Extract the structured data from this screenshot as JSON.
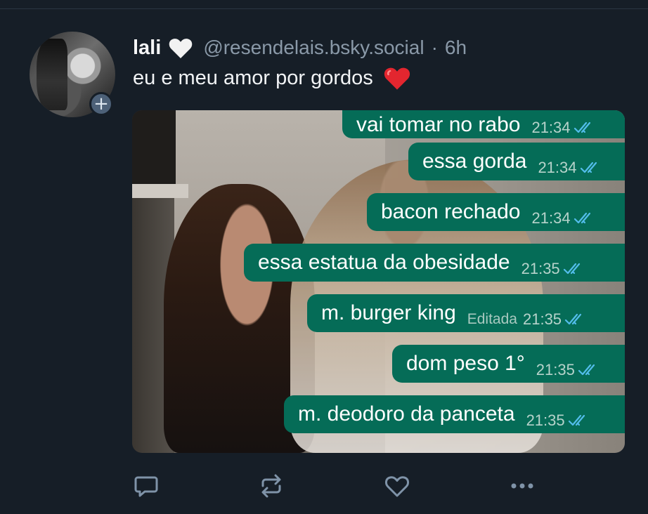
{
  "post": {
    "display_name": "lali",
    "name_emoji": "white-heart-icon",
    "handle": "@resendelais.bsky.social",
    "separator": "·",
    "time": "6h",
    "text": "eu e meu amor por gordos",
    "text_emoji": "red-heart-icon"
  },
  "avatar": {
    "follow_symbol": "+"
  },
  "embed": {
    "messages": [
      {
        "text": "vai tomar no rabo",
        "time": "21:34",
        "edited": ""
      },
      {
        "text": "essa gorda",
        "time": "21:34",
        "edited": ""
      },
      {
        "text": "bacon rechado",
        "time": "21:34",
        "edited": ""
      },
      {
        "text": "essa estatua da obesidade",
        "time": "21:35",
        "edited": ""
      },
      {
        "text": "m. burger king",
        "time": "21:35",
        "edited": "Editada"
      },
      {
        "text": "dom peso 1°",
        "time": "21:35",
        "edited": ""
      },
      {
        "text": "m. deodoro da panceta",
        "time": "21:35",
        "edited": ""
      }
    ]
  },
  "actions": {
    "reply": "reply-icon",
    "repost": "repost-icon",
    "like": "like-icon",
    "more": "more-icon"
  },
  "colors": {
    "background": "#161e27",
    "bubble": "#056c57",
    "read_check": "#53bdeb",
    "muted_text": "#8a99a8",
    "icon": "#7f93a8"
  }
}
